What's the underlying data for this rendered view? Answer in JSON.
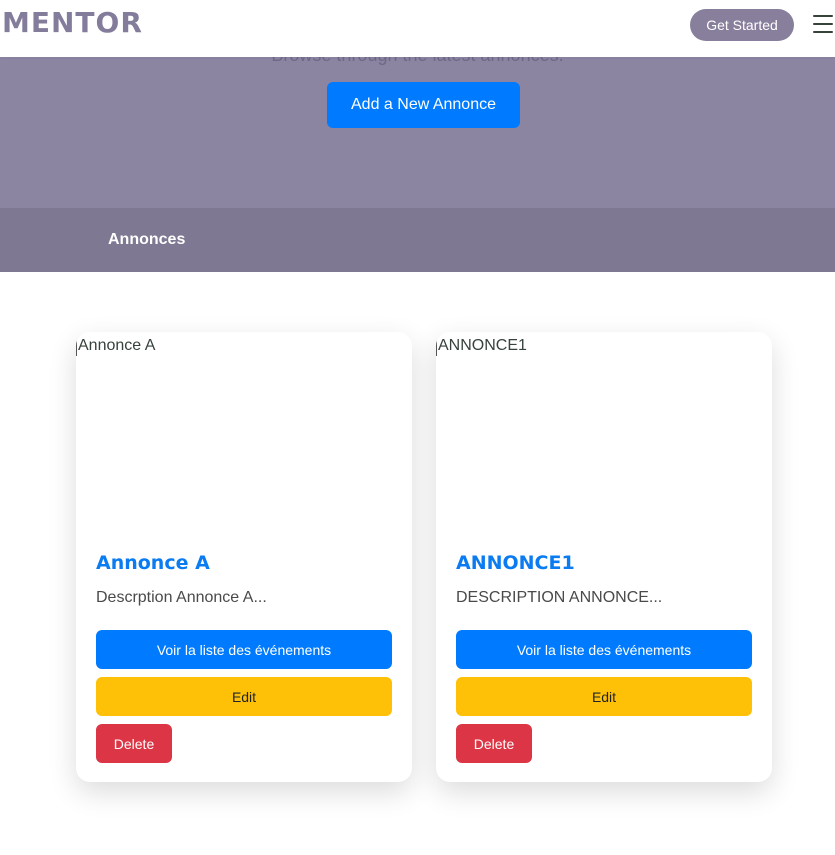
{
  "header": {
    "logo": "MENTOR",
    "cta_label": "Get Started",
    "menu_icon": "hamburger-menu-icon"
  },
  "hero": {
    "subtitle": "Browse through the latest annonces.",
    "add_button_label": "Add a New Annonce"
  },
  "band": {
    "title": "Annonces"
  },
  "colors": {
    "brand": "#877f9c",
    "hero_bg": "#8b85a2",
    "band_bg": "#7e7893",
    "primary": "#007bff",
    "warning": "#ffc107",
    "danger": "#dc3545",
    "title_blue": "#0a7bf0"
  },
  "cards": [
    {
      "image_alt": "Annonce A",
      "title": "Annonce A",
      "description": "Descrption Annonce A...",
      "view_label": "Voir la liste des événements",
      "edit_label": "Edit",
      "delete_label": "Delete"
    },
    {
      "image_alt": "ANNONCE1",
      "title": "ANNONCE1",
      "description": "DESCRIPTION ANNONCE...",
      "view_label": "Voir la liste des événements",
      "edit_label": "Edit",
      "delete_label": "Delete"
    }
  ]
}
